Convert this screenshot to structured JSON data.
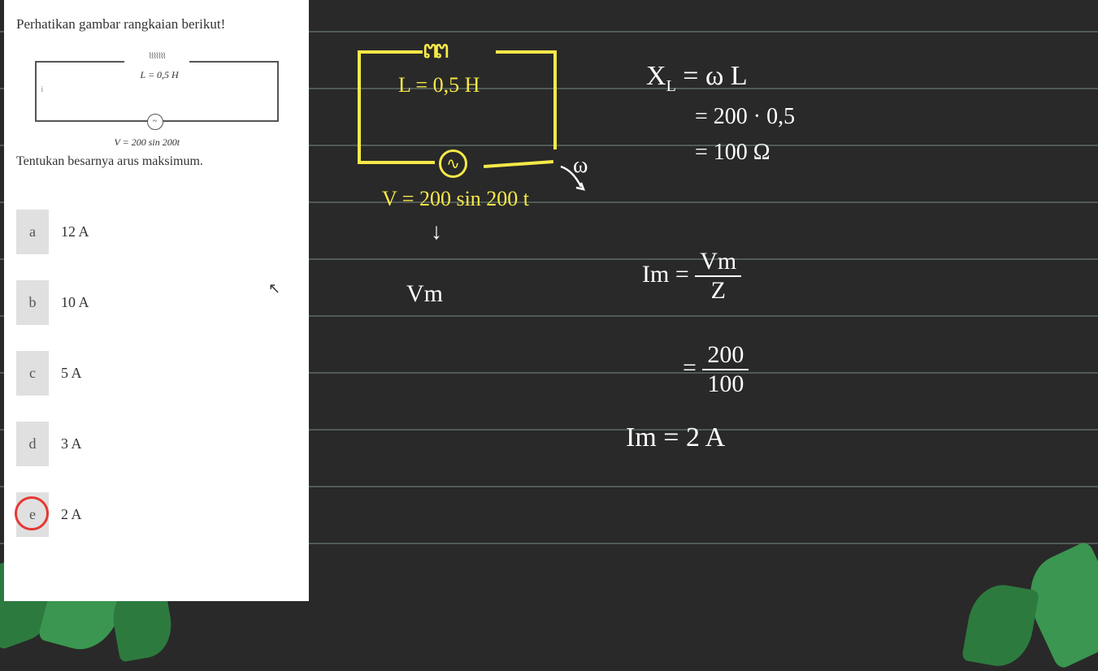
{
  "question": {
    "title": "Perhatikan gambar rangkaian berikut!",
    "inductor_label": "L = 0,5 H",
    "voltage_label": "V = 200 sin 200t",
    "current_indicator": "i",
    "instruction": "Tentukan besarnya arus maksimum."
  },
  "options": [
    {
      "letter": "a",
      "text": "12 A",
      "selected": false
    },
    {
      "letter": "b",
      "text": "10 A",
      "selected": false
    },
    {
      "letter": "c",
      "text": "5 A",
      "selected": false
    },
    {
      "letter": "d",
      "text": "3 A",
      "selected": false
    },
    {
      "letter": "e",
      "text": "2 A",
      "selected": true
    }
  ],
  "handwriting": {
    "circuit_L": "L = 0,5 H",
    "circuit_V": "V = 200 sin 200 t",
    "omega_label": "ω",
    "vm_arrow": "↓",
    "vm_label": "Vm",
    "xl_eq": "X_L = ω L",
    "xl_calc": "= 200 · 0,5",
    "xl_result": "= 100 Ω",
    "im_eq": "Im =",
    "im_frac_num": "Vm",
    "im_frac_den": "Z",
    "im_calc_eq": "=",
    "im_calc_num": "200",
    "im_calc_den": "100",
    "im_result": "Im = 2 A"
  }
}
